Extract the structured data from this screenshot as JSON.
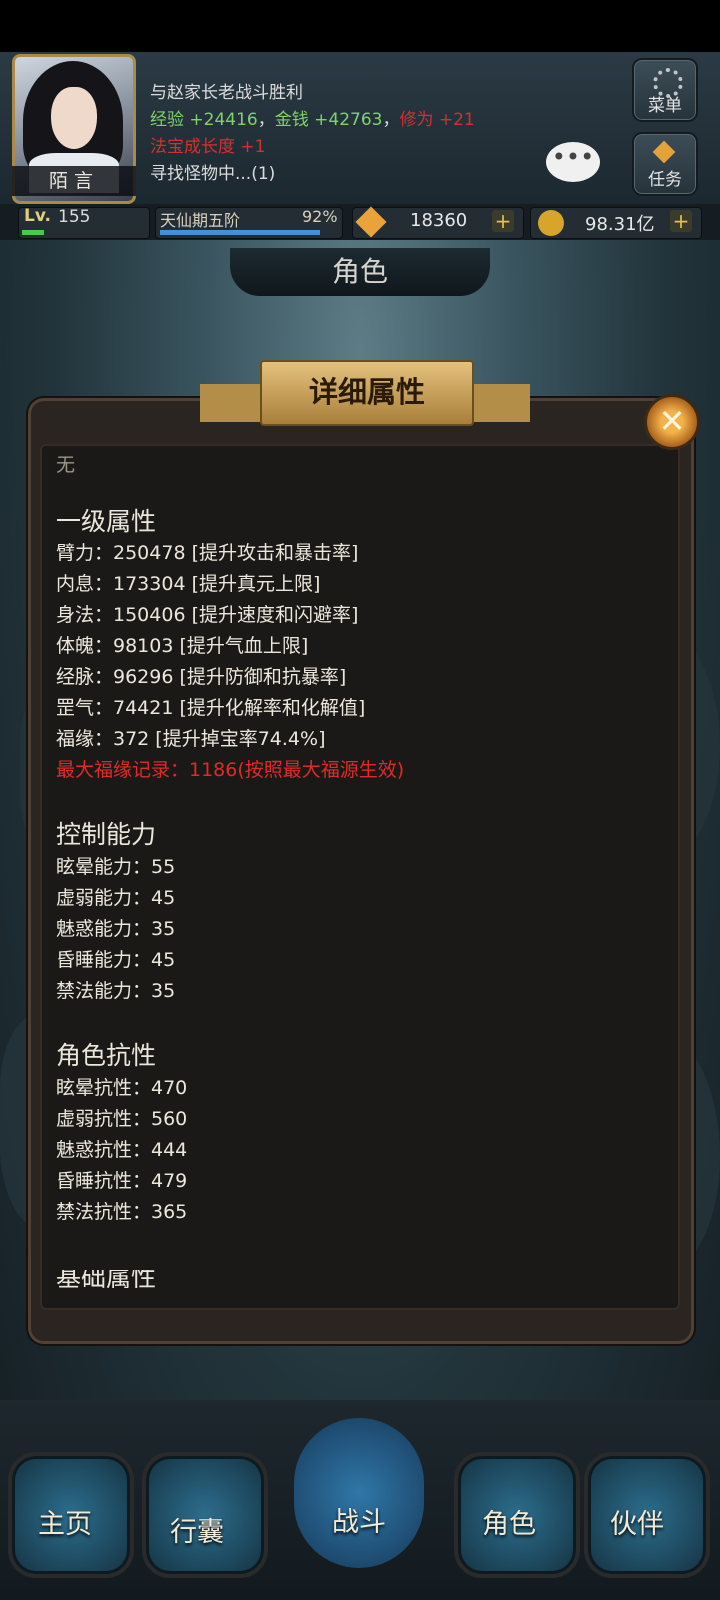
{
  "header": {
    "avatar_name": "陌言",
    "log_line1": "与赵家长老战斗胜利",
    "exp_label": "经验",
    "exp_gain": "+24416",
    "sep": "，",
    "money_label": "金钱",
    "money_gain": "+42763",
    "cultivation_label": "修为",
    "cultivation_gain": "+21",
    "treasure_label": "法宝成长度",
    "treasure_gain": "+1",
    "search_status": "寻找怪物中...(1)",
    "menu_label": "菜单",
    "task_label": "任务",
    "chat_glyph": "•••"
  },
  "stats": {
    "lv_label": "Lv.",
    "level": "155",
    "level_progress": 0.18,
    "realm": "天仙期五阶",
    "realm_pct": "92%",
    "realm_progress": 0.92,
    "gems": "18360",
    "gold": "98.31亿",
    "plus": "+"
  },
  "page_title": "角色",
  "panel": {
    "title": "详细属性",
    "close_glyph": "✕",
    "none_label": "无",
    "section1_title": "一级属性",
    "primary": [
      "臂力：250478 [提升攻击和暴击率]",
      "内息：173304 [提升真元上限]",
      "身法：150406 [提升速度和闪避率]",
      "体魄：98103 [提升气血上限]",
      "经脉：96296 [提升防御和抗暴率]",
      "罡气：74421 [提升化解率和化解值]",
      "福缘：372 [提升掉宝率74.4%]"
    ],
    "max_luck": "最大福缘记录：1186(按照最大福源生效)",
    "section2_title": "控制能力",
    "control": [
      "眩晕能力：55",
      "虚弱能力：45",
      "魅惑能力：35",
      "昏睡能力：45",
      "禁法能力：35"
    ],
    "section3_title": "角色抗性",
    "resist": [
      "眩晕抗性：470",
      "虚弱抗性：560",
      "魅惑抗性：444",
      "昏睡抗性：479",
      "禁法抗性：365"
    ],
    "section4_title": "基础属性"
  },
  "nav": {
    "home": "主页",
    "bag": "行囊",
    "battle": "战斗",
    "role": "角色",
    "partner": "伙伴"
  }
}
